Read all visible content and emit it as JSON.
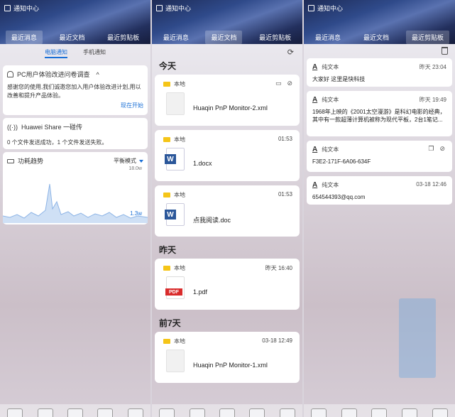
{
  "window_title": "通知中心",
  "tabs": [
    "最近消息",
    "最近文档",
    "最近剪贴板"
  ],
  "panel1": {
    "subtabs": [
      "电脑通知",
      "手机通知"
    ],
    "survey": {
      "title": "PC用户体验改进问卷调查",
      "caret": "^",
      "body": "感谢您的使用,我们诚邀您加入用户体验改进计划,用以改善和提升产品体验。",
      "action": "现在开始"
    },
    "share": {
      "title": "Huawei Share 一碰传",
      "body": "0 个文件发送成功，1 个文件发送失败。"
    },
    "power": {
      "title": "功耗趋势",
      "mode": "平衡模式",
      "max_label": "18.0w",
      "current_label": "1.3w"
    }
  },
  "panel2": {
    "refresh_icon": "refresh-icon",
    "groups": [
      {
        "day": "今天",
        "files": [
          {
            "location": "本地",
            "time": "",
            "name": "Huaqin PnP Monitor-2.xml",
            "type": "xml"
          },
          {
            "location": "本地",
            "time": "01:53",
            "name": "1.docx",
            "type": "word"
          },
          {
            "location": "本地",
            "time": "01:53",
            "name": "点我阅读.doc",
            "type": "word"
          }
        ]
      },
      {
        "day": "昨天",
        "files": [
          {
            "location": "本地",
            "time": "昨天 16:40",
            "name": "1.pdf",
            "type": "pdf"
          }
        ]
      },
      {
        "day": "前7天",
        "files": [
          {
            "location": "本地",
            "time": "03-18 12:49",
            "name": "Huaqin PnP Monitor-1.xml",
            "type": "xml"
          }
        ]
      }
    ],
    "word_letter": "W",
    "pdf_label": "PDF"
  },
  "panel3": {
    "clips": [
      {
        "type": "纯文本",
        "time": "昨天 23:04",
        "text": "大家好 这里是快科技"
      },
      {
        "type": "纯文本",
        "time": "昨天 19:49",
        "text": "1968年上映的《2001太空漫游》是科幻电影的经典，其中有一款超薄计算机被称为现代平板，2台1笔记..."
      },
      {
        "type": "纯文本",
        "time": "",
        "text": "F3E2-171F-6A06-634F"
      },
      {
        "type": "纯文本",
        "time": "03-18 12:46",
        "text": "654544393@qq.com"
      }
    ],
    "text_icon_letter": "A"
  },
  "colors": {
    "accent": "#1a6fd6",
    "header_dark": "#1d2a55",
    "folder": "#f5c518",
    "word": "#2b579a",
    "pdf": "#d92b2b"
  }
}
